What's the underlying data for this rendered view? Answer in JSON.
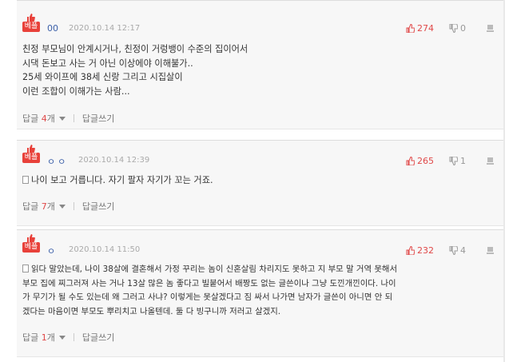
{
  "badge_label": "베플",
  "reply_label": "답글",
  "count_suffix": "개",
  "write_reply_label": "답글쓰기",
  "comments": [
    {
      "nick": "00",
      "date": "2020.10.14 12:17",
      "up": "274",
      "down": "0",
      "lines": [
        "친정 부모님이 안계시거나, 친정이 거렁뱅이 수준의 집이어서",
        "시댁 돈보고 사는 거 아닌 이상에야 이해불가..",
        "25세 와이프에 38세 신랑 그리고 시집살이",
        "이런 조합이 이해가는 사람..."
      ],
      "reply_count": "4"
    },
    {
      "nick": "ㅇㅇ",
      "date": "2020.10.14 12:39",
      "up": "265",
      "down": "1",
      "lines": [
        "나이 보고 거릅니다. 자기 팔자 자기가 꼬는 거죠."
      ],
      "reply_count": "7"
    },
    {
      "nick": "ㅇ",
      "date": "2020.10.14 11:50",
      "up": "232",
      "down": "4",
      "lines": [
        "읽다 말았는데, 나이 38살에 결혼해서 가정 꾸리는 놈이 신혼살림 차리지도 못하고 지 부모 말 거역 못해서",
        "부모 집에 찌그러져 사는 거나 13살 많은 놈 좋다고 빌붙어서 배짱도 없는 글쓴이나 그냥 도낀개낀이다. 나이",
        "가 무기가 될 수도 있는데 왜 그러고 사냐? 이렇게는 못살겠다고 짐 싸서 나가면 남자가 글쓴이 아니면 안 되",
        "겠다는 마음이면 부모도 뿌리치고 나올텐데. 둘 다 빙구니까 저러고 살겠지."
      ],
      "reply_count": "1"
    }
  ]
}
